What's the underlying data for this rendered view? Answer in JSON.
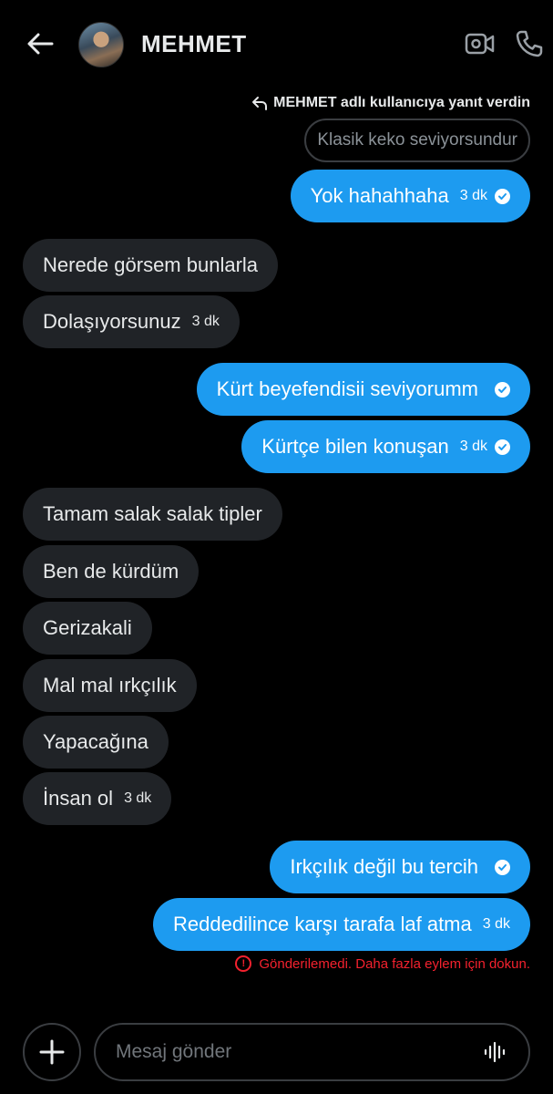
{
  "header": {
    "title": "MEHMET",
    "back_icon": "arrow-left-icon",
    "video_icon": "video-camera-icon",
    "phone_icon": "phone-icon"
  },
  "reply_context": {
    "note": "MEHMET adlı kullanıcıya yanıt verdin",
    "quoted_text": "Klasik keko seviyorsundur",
    "icon": "reply-arrow-icon"
  },
  "messages": [
    {
      "text": "Yok hahahhaha",
      "time": "3 dk",
      "outgoing": true
    },
    {
      "text": "Nerede görsem bunlarla",
      "time": "",
      "outgoing": false
    },
    {
      "text": "Dolaşıyorsunuz",
      "time": "3 dk",
      "outgoing": false
    },
    {
      "text": "Kürt beyefendisii seviyorumm",
      "time": "",
      "outgoing": true
    },
    {
      "text": "Kürtçe bilen konuşan",
      "time": "3 dk",
      "outgoing": true
    },
    {
      "text": "Tamam salak salak tipler",
      "time": "",
      "outgoing": false
    },
    {
      "text": "Ben de kürdüm",
      "time": "",
      "outgoing": false
    },
    {
      "text": "Gerizakali",
      "time": "",
      "outgoing": false
    },
    {
      "text": "Mal mal ırkçılık",
      "time": "",
      "outgoing": false
    },
    {
      "text": "Yapacağına",
      "time": "",
      "outgoing": false
    },
    {
      "text": "İnsan ol",
      "time": "3 dk",
      "outgoing": false
    },
    {
      "text": "Irkçılık değil bu tercih",
      "time": "",
      "outgoing": true
    },
    {
      "text": "Reddedilince karşı tarafa laf atma",
      "time": "3 dk",
      "outgoing": true
    }
  ],
  "error": {
    "text": "Gönderilemedi. Daha fazla eylem için dokun.",
    "icon": "alert-circle-icon"
  },
  "composer": {
    "placeholder": "Mesaj gönder",
    "value": "",
    "plus_icon": "plus-icon",
    "voice_icon": "voice-waveform-icon"
  },
  "colors": {
    "accent": "#1d9bf0",
    "incoming_bubble": "#202327",
    "error": "#f4212e"
  }
}
